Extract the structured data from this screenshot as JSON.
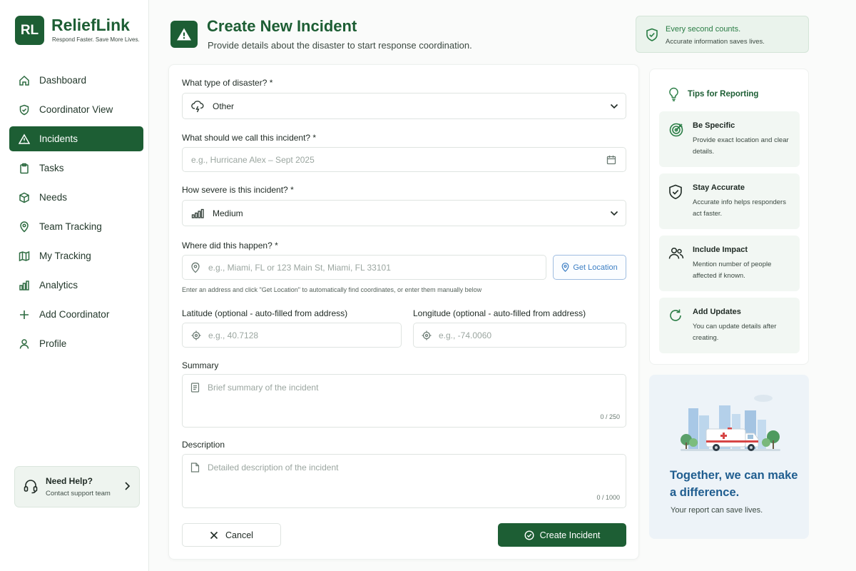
{
  "brand": {
    "logo": "RL",
    "name": "ReliefLink",
    "tagline": "Respond Faster. Save More Lives."
  },
  "nav": [
    {
      "label": "Dashboard",
      "icon": "home-icon"
    },
    {
      "label": "Coordinator View",
      "icon": "shield-icon"
    },
    {
      "label": "Incidents",
      "icon": "warning-icon",
      "active": true
    },
    {
      "label": "Tasks",
      "icon": "clipboard-icon"
    },
    {
      "label": "Needs",
      "icon": "box-icon"
    },
    {
      "label": "Team Tracking",
      "icon": "map-pin-icon"
    },
    {
      "label": "My Tracking",
      "icon": "map-icon"
    },
    {
      "label": "Analytics",
      "icon": "bar-chart-icon"
    },
    {
      "label": "Add Coordinator",
      "icon": "plus-icon"
    },
    {
      "label": "Profile",
      "icon": "user-icon"
    }
  ],
  "help": {
    "title": "Need Help?",
    "subtitle": "Contact support team"
  },
  "header": {
    "title": "Create New Incident",
    "subtitle": "Provide details about the disaster to start response coordination."
  },
  "banner": {
    "title": "Every second counts.",
    "subtitle": "Accurate information saves lives."
  },
  "form": {
    "type_label": "What type of disaster? *",
    "type_value": "Other",
    "name_label": "What should we call this incident? *",
    "name_placeholder": "e.g., Hurricane Alex – Sept 2025",
    "severity_label": "How severe is this incident? *",
    "severity_value": "Medium",
    "location_label": "Where did this happen? *",
    "location_placeholder": "e.g., Miami, FL or 123 Main St, Miami, FL 33101",
    "get_location": "Get Location",
    "location_hint": "Enter an address and click \"Get Location\" to automatically find coordinates, or enter them manually below",
    "lat_label": "Latitude (optional - auto-filled from address)",
    "lat_placeholder": "e.g., 40.7128",
    "lng_label": "Longitude (optional - auto-filled from address)",
    "lng_placeholder": "e.g., -74.0060",
    "summary_label": "Summary",
    "summary_placeholder": "Brief summary of the incident",
    "summary_count": "0 / 250",
    "description_label": "Description",
    "description_placeholder": "Detailed description of the incident",
    "description_count": "0 / 1000",
    "cancel": "Cancel",
    "submit": "Create Incident"
  },
  "tips": {
    "title": "Tips for Reporting",
    "items": [
      {
        "title": "Be Specific",
        "text": "Provide exact location and clear details.",
        "icon": "target-icon"
      },
      {
        "title": "Stay Accurate",
        "text": "Accurate info helps responders act faster.",
        "icon": "shield-check-icon"
      },
      {
        "title": "Include Impact",
        "text": "Mention number of people affected if known.",
        "icon": "users-icon"
      },
      {
        "title": "Add Updates",
        "text": "You can update details after creating.",
        "icon": "refresh-icon"
      }
    ]
  },
  "promo": {
    "title": "Together, we can make a difference.",
    "subtitle": "Your report can save lives."
  },
  "colors": {
    "primary": "#1d5e34",
    "accent_blue": "#1f5d8f",
    "link_blue": "#3d7fc4"
  }
}
